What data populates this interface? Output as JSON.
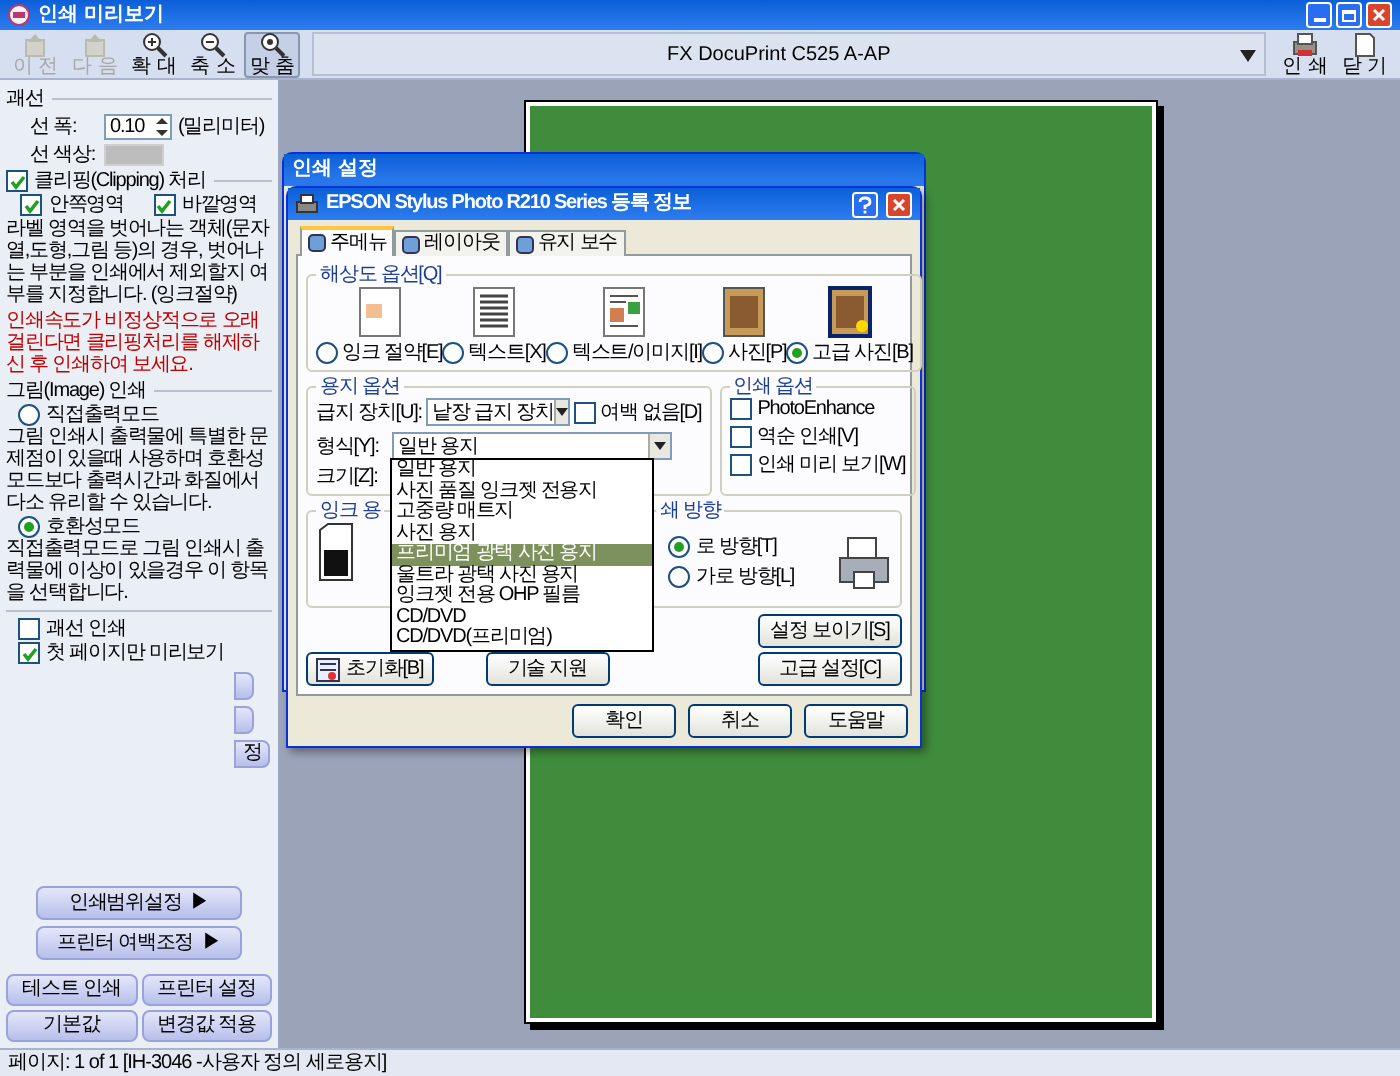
{
  "window": {
    "title": "인쇄 미리보기"
  },
  "toolbar": {
    "items": [
      {
        "kind": "button",
        "label": "이 전",
        "disabled": true,
        "pressed": false
      },
      {
        "kind": "button",
        "label": "다 음",
        "disabled": true,
        "pressed": false
      },
      {
        "kind": "button",
        "label": "확 대",
        "disabled": false,
        "pressed": false
      },
      {
        "kind": "button",
        "label": "축 소",
        "disabled": false,
        "pressed": false
      },
      {
        "kind": "button",
        "label": "맞 춤",
        "disabled": false,
        "pressed": true
      },
      {
        "kind": "combo",
        "label": "FX DocuPrint C525 A-AP"
      },
      {
        "kind": "button",
        "label": "인 쇄",
        "disabled": false,
        "pressed": false
      },
      {
        "kind": "button",
        "label": "닫 기",
        "disabled": false,
        "pressed": false
      }
    ]
  },
  "left_panel": {
    "line": {
      "title": "괘선",
      "width_label": "선 폭:",
      "width_value": "0.10",
      "width_unit": "(밀리미터)",
      "color_label": "선 색상:"
    },
    "clipping": {
      "label": "클리핑(Clipping) 처리",
      "checked": true,
      "options": [
        {
          "label": "안쪽영역",
          "checked": true
        },
        {
          "label": "바깥영역",
          "checked": true
        }
      ],
      "description": "라벨 영역을 벗어나는 객체(문자열,도형,그림 등)의 경우, 벗어나는 부분을 인쇄에서 제외할지 여부를 지정합니다. (잉크절약)",
      "warning": "인쇄속도가 비정상적으로 오래 걸린다면 클리핑처리를 해제하신 후 인쇄하여 보세요."
    },
    "image_print": {
      "title": "그림(Image) 인쇄",
      "modes": [
        {
          "label": "직접출력모드",
          "selected": false,
          "description": "그림 인쇄시 출력물에 특별한 문제점이 있을때 사용하며 호환성모드보다 출력시간과 화질에서 다소 유리할 수 있습니다."
        },
        {
          "label": "호환성모드",
          "selected": true,
          "description": "직접출력모드로 그림 인쇄시 출력물에 이상이 있을경우 이 항목을 선택합니다."
        }
      ]
    },
    "options": [
      {
        "label": "괘선 인쇄",
        "checked": false
      },
      {
        "label": "첫 페이지만 미리보기",
        "checked": true
      }
    ],
    "cut_buttons": [
      {
        "kind": "blank"
      },
      {
        "kind": "blank"
      },
      {
        "kind": "text",
        "label": "정"
      }
    ],
    "menu_buttons": [
      {
        "label": "인쇄범위설정",
        "arrow": "▶"
      },
      {
        "label": "프린터 여백조정",
        "arrow": "▶"
      }
    ],
    "action_buttons": [
      "테스트 인쇄",
      "프린터 설정",
      "기본값",
      "변경값 적용"
    ]
  },
  "back_dialog": {
    "title": "인쇄 설정"
  },
  "dialog": {
    "title": "EPSON Stylus Photo R210 Series 등록 정보",
    "tabs": [
      {
        "label": "주메뉴",
        "selected": true
      },
      {
        "label": "레이아웃",
        "selected": false
      },
      {
        "label": "유지 보수",
        "selected": false
      }
    ],
    "quality": {
      "title": "해상도 옵션[Q]",
      "options": [
        {
          "label": "잉크 절약[E]",
          "selected": false
        },
        {
          "label": "텍스트[X]",
          "selected": false
        },
        {
          "label": "텍스트/이미지[I]",
          "selected": false
        },
        {
          "label": "사진[P]",
          "selected": false
        },
        {
          "label": "고급 사진[B]",
          "selected": true
        }
      ]
    },
    "paper": {
      "title": "용지 옵션",
      "source_label": "급지 장치[U]:",
      "source_value": "낱장 급지 장치",
      "borderless": {
        "label": "여백 없음[D]",
        "checked": false
      },
      "type_label": "형식[Y]:",
      "type_value": "일반 용지",
      "size_label": "크기[Z]:",
      "type_list": [
        {
          "label": "일반 용지",
          "selected": false
        },
        {
          "label": "사진 품질 잉크젯 전용지",
          "selected": false
        },
        {
          "label": "고중량 매트지",
          "selected": false
        },
        {
          "label": "사진 용지",
          "selected": false
        },
        {
          "label": "프리미엄 광택 사진 용지",
          "selected": true
        },
        {
          "label": "울트라 광택 사진 용지",
          "selected": false
        },
        {
          "label": "잉크젯 전용 OHP 필름",
          "selected": false
        },
        {
          "label": "CD/DVD",
          "selected": false
        },
        {
          "label": "CD/DVD(프리미엄)",
          "selected": false
        }
      ]
    },
    "print_options": {
      "title": "인쇄 옵션",
      "items": [
        {
          "label": "PhotoEnhance",
          "checked": false
        },
        {
          "label": "역순 인쇄[V]",
          "checked": false
        },
        {
          "label": "인쇄 미리 보기[W]",
          "checked": false
        }
      ]
    },
    "ink": {
      "title": "잉크 용"
    },
    "orientation": {
      "title": "쇄 방향",
      "options": [
        {
          "label": "로 방향[T]",
          "selected": true
        },
        {
          "label": "가로 방향[L]",
          "selected": false
        }
      ]
    },
    "reset_button": "초기화[B]",
    "support_button": "기술 지원",
    "side_buttons": [
      "설정 보이기[S]",
      "고급 설정[C]"
    ],
    "footer_buttons": [
      "확인",
      "취소",
      "도움말"
    ]
  },
  "status_bar": "페이지: 1 of 1 [IH-3046 -사용자 정의 세로용지]"
}
